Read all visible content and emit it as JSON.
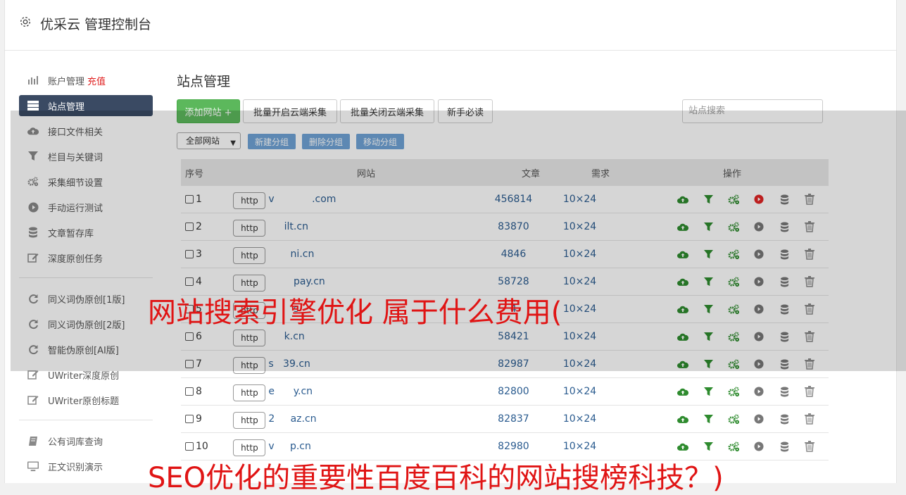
{
  "app": {
    "title": "优采云 管理控制台"
  },
  "sidebar": {
    "items": [
      {
        "label": "账户管理",
        "extra": "充值",
        "icon": "bar-chart-icon"
      },
      {
        "label": "站点管理",
        "icon": "server-icon",
        "active": true
      },
      {
        "label": "接口文件相关",
        "icon": "cloud-upload-icon"
      },
      {
        "label": "栏目与关键词",
        "icon": "filter-icon"
      },
      {
        "label": "采集细节设置",
        "icon": "cogs-icon"
      },
      {
        "label": "手动运行测试",
        "icon": "play-circle-icon"
      },
      {
        "label": "文章暂存库",
        "icon": "database-icon"
      },
      {
        "label": "深度原创任务",
        "icon": "edit-icon"
      },
      {
        "label": "同义词伪原创[1版]",
        "icon": "refresh-icon"
      },
      {
        "label": "同义词伪原创[2版]",
        "icon": "refresh-icon"
      },
      {
        "label": "智能伪原创[AI版]",
        "icon": "refresh-icon"
      },
      {
        "label": "UWriter深度原创",
        "icon": "edit-icon"
      },
      {
        "label": "UWriter原创标题",
        "icon": "edit-icon"
      },
      {
        "label": "公有词库查询",
        "icon": "book-icon"
      },
      {
        "label": "正文识别演示",
        "icon": "monitor-icon"
      }
    ]
  },
  "main": {
    "title": "站点管理",
    "toolbar": {
      "add_site": "添加网站 +",
      "batch_open": "批量开启云端采集",
      "batch_close": "批量关闭云端采集",
      "newbie": "新手必读",
      "search_placeholder": "站点搜索"
    },
    "filter": {
      "select_value": "全部网站",
      "new_group": "新建分组",
      "delete_group": "删除分组",
      "move_group": "移动分组"
    },
    "table": {
      "headers": {
        "no": "序号",
        "site": "网站",
        "articles": "文章",
        "demand": "需求",
        "ops": "操作"
      },
      "rows": [
        {
          "no": "1",
          "protocol": "http",
          "domain": "v            .com",
          "articles": "456814",
          "demand": "10×24"
        },
        {
          "no": "2",
          "protocol": "http",
          "domain": "     ilt.cn",
          "articles": "83870",
          "demand": "10×24"
        },
        {
          "no": "3",
          "protocol": "http",
          "domain": "       ni.cn",
          "articles": "4846",
          "demand": "10×24"
        },
        {
          "no": "4",
          "protocol": "http",
          "domain": "        pay.cn",
          "articles": "58728",
          "demand": "10×24"
        },
        {
          "no": "5",
          "protocol": "http",
          "domain": "        s",
          "articles": "4",
          "demand": "10×24"
        },
        {
          "no": "6",
          "protocol": "http",
          "domain": "     k.cn",
          "articles": "58421",
          "demand": "10×24"
        },
        {
          "no": "7",
          "protocol": "http",
          "domain": "s   39.cn",
          "articles": "82987",
          "demand": "10×24"
        },
        {
          "no": "8",
          "protocol": "http",
          "domain": "e      y.cn",
          "articles": "82800",
          "demand": "10×24"
        },
        {
          "no": "9",
          "protocol": "http",
          "domain": "2     az.cn",
          "articles": "82837",
          "demand": "10×24"
        },
        {
          "no": "10",
          "protocol": "http",
          "domain": "v     p.cn",
          "articles": "82980",
          "demand": "10×24"
        }
      ]
    }
  },
  "overlay_text": {
    "line1": "网站搜索引擎优化 属于什么费用(",
    "line2": "SEO优化的重要性百度百科的网站搜榜科技？)"
  },
  "colors": {
    "accent_green": "#5cb85c",
    "sidebar_active": "#3a4a63",
    "link_blue": "#2a5b8f",
    "ad_red": "#e01414"
  }
}
